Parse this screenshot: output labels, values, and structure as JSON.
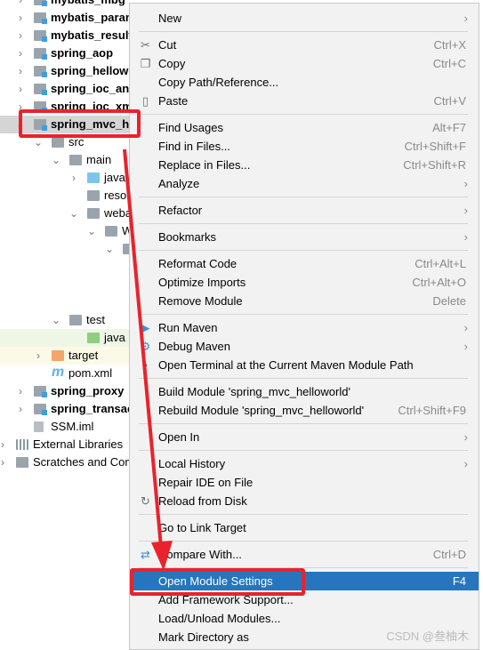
{
  "project_tree": [
    {
      "label": "mybatis_mbg",
      "depth": 0,
      "icon": "module-icon",
      "bold": true,
      "chevron": "right"
    },
    {
      "label": "mybatis_parameter",
      "depth": 0,
      "icon": "module-icon",
      "bold": true,
      "chevron": "right"
    },
    {
      "label": "mybatis_result",
      "depth": 0,
      "icon": "module-icon",
      "bold": true,
      "chevron": "right"
    },
    {
      "label": "spring_aop",
      "depth": 0,
      "icon": "module-icon",
      "bold": true,
      "chevron": "right"
    },
    {
      "label": "spring_helloworld",
      "depth": 0,
      "icon": "module-icon",
      "bold": true,
      "chevron": "right"
    },
    {
      "label": "spring_ioc_annotation",
      "depth": 0,
      "icon": "module-icon",
      "bold": true,
      "chevron": "right"
    },
    {
      "label": "spring_ioc_xml",
      "depth": 0,
      "icon": "module-icon",
      "bold": true,
      "chevron": "right"
    },
    {
      "label": "spring_mvc_helloworld",
      "depth": 0,
      "icon": "module-icon",
      "bold": true,
      "chevron": "down",
      "selected": true
    },
    {
      "label": "src",
      "depth": 1,
      "icon": "folder-icon",
      "chevron": "down"
    },
    {
      "label": "main",
      "depth": 2,
      "icon": "folder-icon",
      "chevron": "down"
    },
    {
      "label": "java",
      "depth": 3,
      "icon": "source-folder-icon",
      "chevron": "right"
    },
    {
      "label": "resources",
      "depth": 3,
      "icon": "resources-folder-icon",
      "chevron": ""
    },
    {
      "label": "webapp",
      "depth": 3,
      "icon": "web-folder-icon",
      "chevron": "down"
    },
    {
      "label": "WEB-INF",
      "depth": 4,
      "icon": "folder-icon",
      "chevron": "down"
    },
    {
      "label": "",
      "depth": 5,
      "icon": "folder-icon",
      "chevron": "down"
    },
    {
      "label": "",
      "depth": 6,
      "icon": "",
      "chevron": ""
    },
    {
      "label": "",
      "depth": 6,
      "icon": "spring-xml-file-icon",
      "chevron": ""
    },
    {
      "label": "",
      "depth": 6,
      "icon": "xml-file-icon",
      "chevron": ""
    },
    {
      "label": "test",
      "depth": 2,
      "icon": "folder-icon",
      "chevron": "down"
    },
    {
      "label": "java",
      "depth": 3,
      "icon": "test-folder-icon",
      "chevron": "",
      "bg": "green"
    },
    {
      "label": "target",
      "depth": 1,
      "icon": "excluded-folder-icon",
      "chevron": "right",
      "bg": "yellow"
    },
    {
      "label": "pom.xml",
      "depth": 1,
      "icon": "maven-icon",
      "chevron": ""
    },
    {
      "label": "spring_proxy",
      "depth": 0,
      "icon": "module-icon",
      "bold": true,
      "chevron": "right"
    },
    {
      "label": "spring_transaction",
      "depth": 0,
      "icon": "module-icon",
      "bold": true,
      "chevron": "right"
    },
    {
      "label": "SSM.iml",
      "depth": 0,
      "icon": "iml-file-icon",
      "chevron": ""
    },
    {
      "label": "External Libraries",
      "depth": -1,
      "icon": "libraries-icon",
      "chevron": "right"
    },
    {
      "label": "Scratches and Consoles",
      "depth": -1,
      "icon": "scratches-icon",
      "chevron": "right"
    }
  ],
  "context_menu": [
    {
      "label": "New",
      "submenu": true
    },
    {
      "sep": true
    },
    {
      "label": "Cut",
      "shortcut": "Ctrl+X",
      "icon": "scissors-icon"
    },
    {
      "label": "Copy",
      "shortcut": "Ctrl+C",
      "icon": "copy-icon"
    },
    {
      "label": "Copy Path/Reference..."
    },
    {
      "label": "Paste",
      "shortcut": "Ctrl+V",
      "icon": "paste-icon"
    },
    {
      "sep": true
    },
    {
      "label": "Find Usages",
      "shortcut": "Alt+F7"
    },
    {
      "label": "Find in Files...",
      "shortcut": "Ctrl+Shift+F"
    },
    {
      "label": "Replace in Files...",
      "shortcut": "Ctrl+Shift+R"
    },
    {
      "label": "Analyze",
      "submenu": true
    },
    {
      "sep": true
    },
    {
      "label": "Refactor",
      "submenu": true
    },
    {
      "sep": true
    },
    {
      "label": "Bookmarks",
      "submenu": true
    },
    {
      "sep": true
    },
    {
      "label": "Reformat Code",
      "shortcut": "Ctrl+Alt+L"
    },
    {
      "label": "Optimize Imports",
      "shortcut": "Ctrl+Alt+O"
    },
    {
      "label": "Remove Module",
      "shortcut": "Delete"
    },
    {
      "sep": true
    },
    {
      "label": "Run Maven",
      "submenu": true,
      "icon": "run-maven-icon"
    },
    {
      "label": "Debug Maven",
      "submenu": true,
      "icon": "debug-maven-icon"
    },
    {
      "label": "Open Terminal at the Current Maven Module Path",
      "icon": "terminal-icon"
    },
    {
      "sep": true
    },
    {
      "label": "Build Module 'spring_mvc_helloworld'"
    },
    {
      "label": "Rebuild Module 'spring_mvc_helloworld'",
      "shortcut": "Ctrl+Shift+F9"
    },
    {
      "sep": true
    },
    {
      "label": "Open In",
      "submenu": true
    },
    {
      "sep": true
    },
    {
      "label": "Local History",
      "submenu": true
    },
    {
      "label": "Repair IDE on File"
    },
    {
      "label": "Reload from Disk",
      "icon": "reload-icon"
    },
    {
      "sep": true
    },
    {
      "label": "Go to Link Target"
    },
    {
      "sep": true
    },
    {
      "label": "Compare With...",
      "shortcut": "Ctrl+D",
      "icon": "compare-icon"
    },
    {
      "sep": true
    },
    {
      "label": "Open Module Settings",
      "shortcut": "F4",
      "highlighted": true
    },
    {
      "label": "Add Framework Support..."
    },
    {
      "label": "Load/Unload Modules..."
    },
    {
      "label": "Mark Directory as"
    }
  ],
  "watermark": "CSDN @叁柚木",
  "colors": {
    "highlight": "#2675bf",
    "annotation": "#e8232d"
  }
}
